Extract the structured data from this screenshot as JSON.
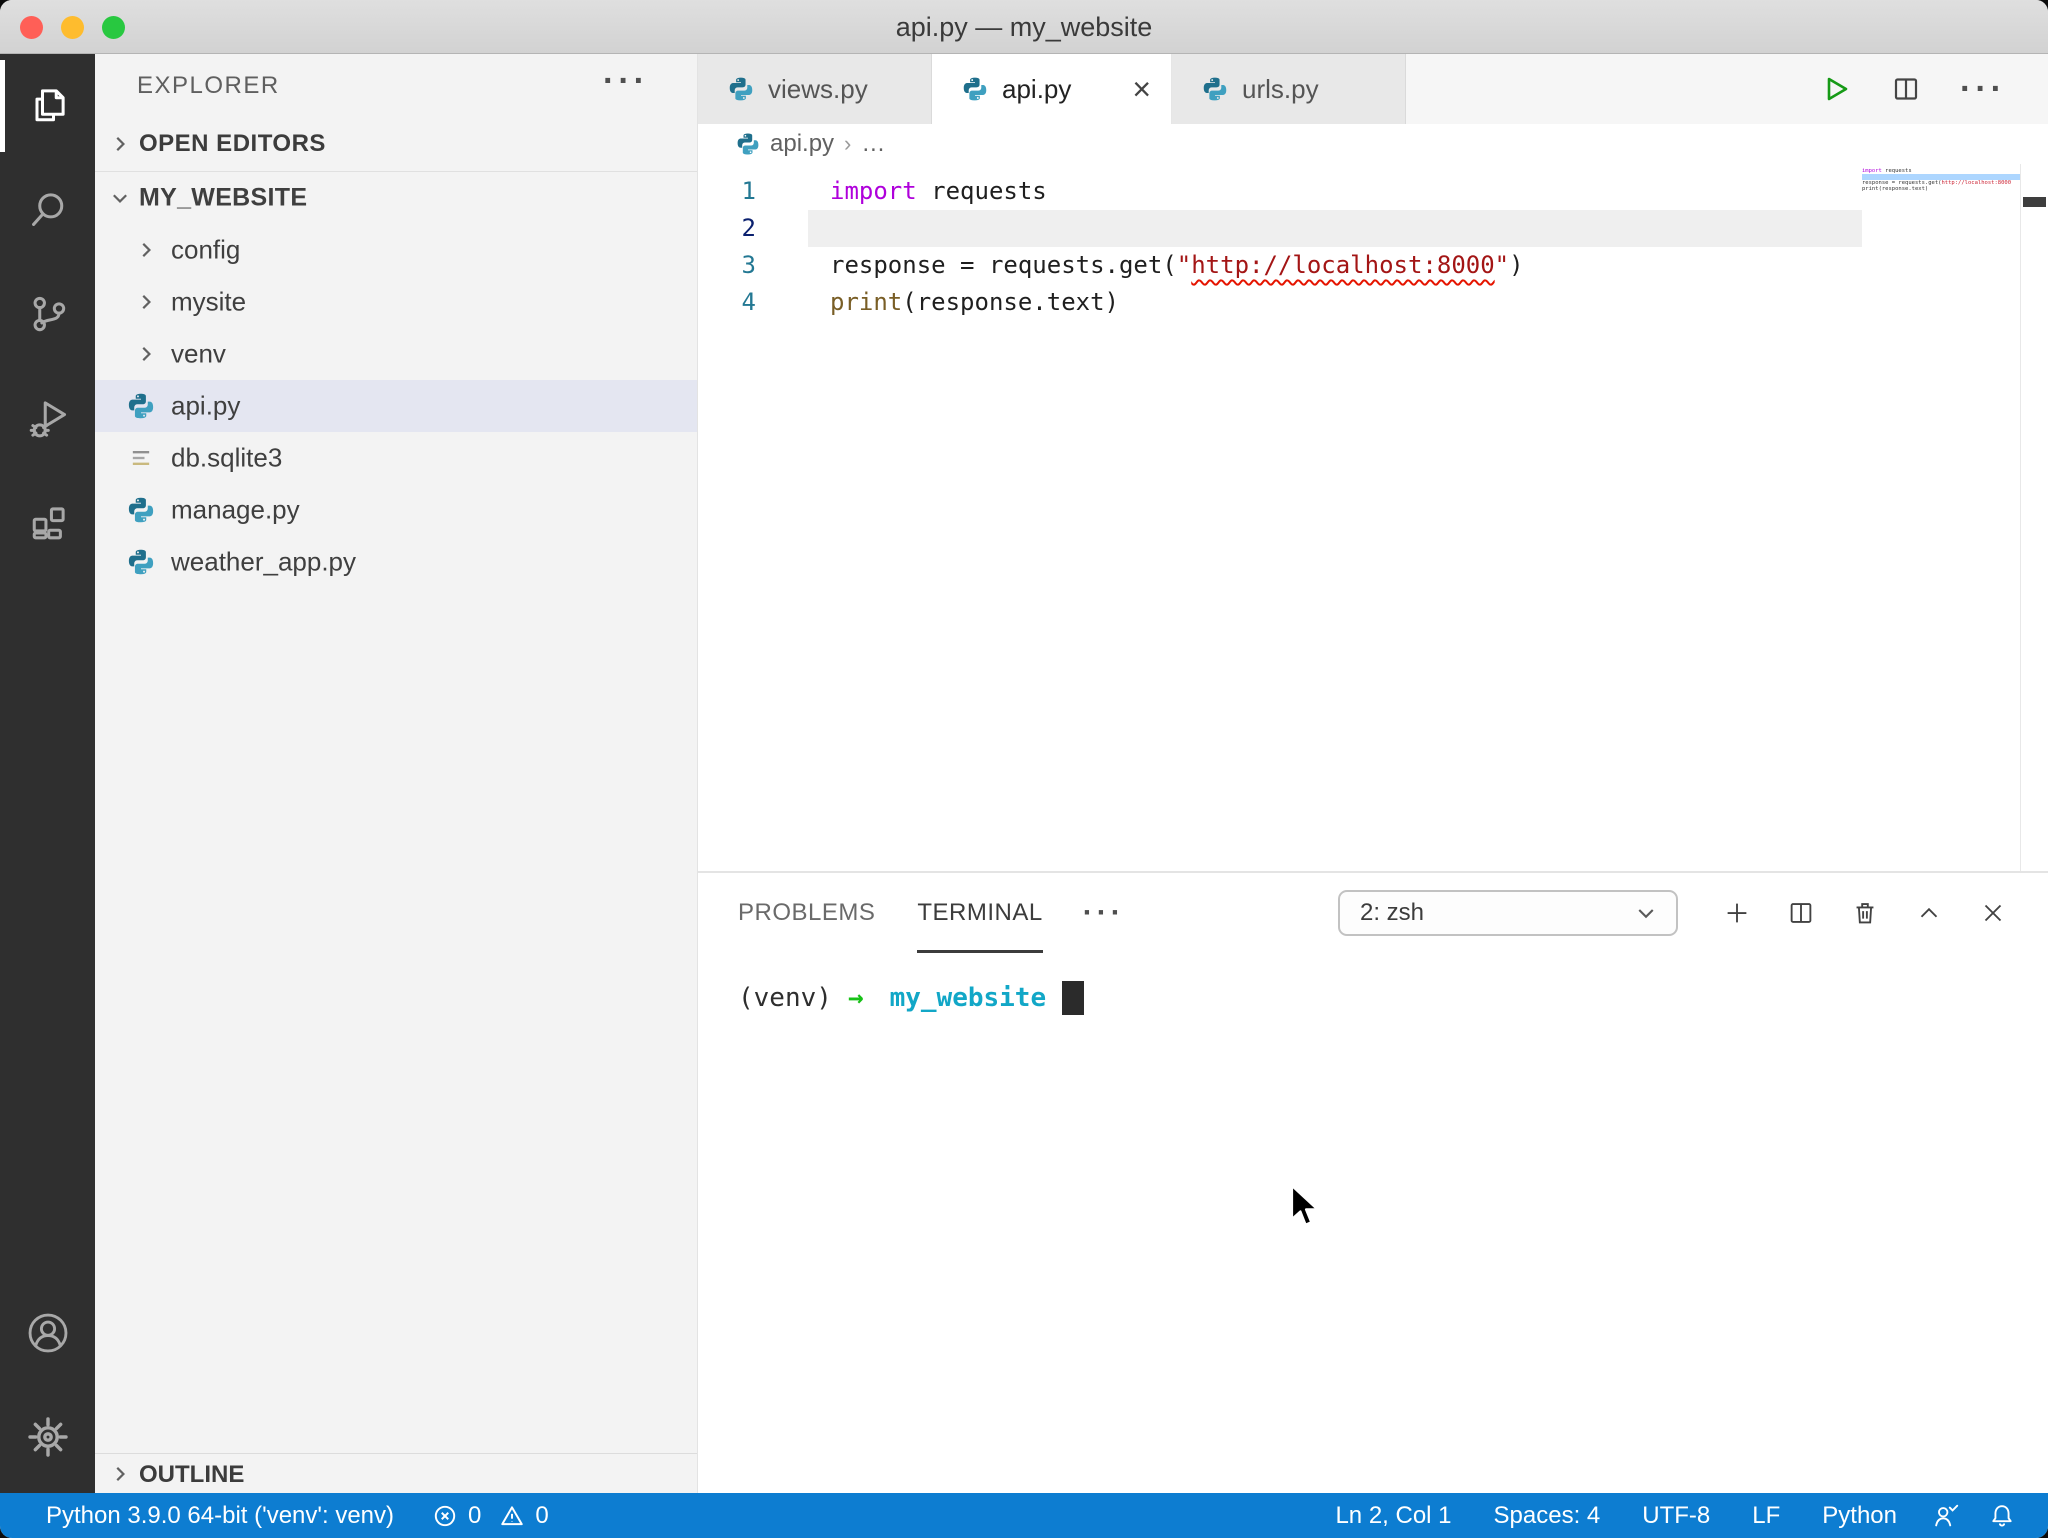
{
  "window": {
    "title": "api.py — my_website"
  },
  "explorer": {
    "header": "EXPLORER",
    "header_more": "···",
    "open_editors": "OPEN EDITORS",
    "root": "MY_WEBSITE",
    "items": [
      {
        "label": "config",
        "type": "folder"
      },
      {
        "label": "mysite",
        "type": "folder"
      },
      {
        "label": "venv",
        "type": "folder"
      },
      {
        "label": "api.py",
        "type": "python",
        "selected": true
      },
      {
        "label": "db.sqlite3",
        "type": "database"
      },
      {
        "label": "manage.py",
        "type": "python"
      },
      {
        "label": "weather_app.py",
        "type": "python"
      }
    ],
    "outline": "OUTLINE"
  },
  "tabs": {
    "items": [
      {
        "label": "views.py",
        "active": false
      },
      {
        "label": "api.py",
        "active": true
      },
      {
        "label": "urls.py",
        "active": false
      }
    ],
    "close_glyph": "×"
  },
  "editor_actions": {
    "more": "···"
  },
  "breadcrumb": {
    "file": "api.py",
    "sep": "›",
    "more": "…"
  },
  "editor": {
    "lines": {
      "l1": {
        "num": "1",
        "kw": "import",
        "rest": " requests"
      },
      "l2": {
        "num": "2"
      },
      "l3": {
        "num": "3",
        "pre": "response = requests.get(",
        "q1": "\"",
        "url": "http://localhost:8000",
        "q2": "\"",
        "post": ")"
      },
      "l4": {
        "num": "4",
        "fn": "print",
        "args": "(response.text)"
      }
    }
  },
  "panel": {
    "problems": "PROBLEMS",
    "terminal": "TERMINAL",
    "more": "···",
    "shell_selector": "2: zsh",
    "prompt": {
      "venv": "(venv)",
      "arrow": "→",
      "cwd": "my_website"
    }
  },
  "status_bar": {
    "python_version": "Python 3.9.0 64-bit ('venv': venv)",
    "errors": "0",
    "warnings": "0",
    "cursor_position": "Ln 2, Col 1",
    "indent": "Spaces: 4",
    "encoding": "UTF-8",
    "eol": "LF",
    "language": "Python"
  },
  "colors": {
    "status_bar": "#0D7DD1",
    "title_bar": "#D9D9D9",
    "activity_bar": "#2F2F2F",
    "selected_row": "#E4E6F1",
    "keyword": "#AF00DB",
    "function": "#795E26",
    "string": "#A31515",
    "squiggle": "#E51400",
    "terminal_cwd": "#12A7C7",
    "terminal_arrow": "#17C117"
  }
}
